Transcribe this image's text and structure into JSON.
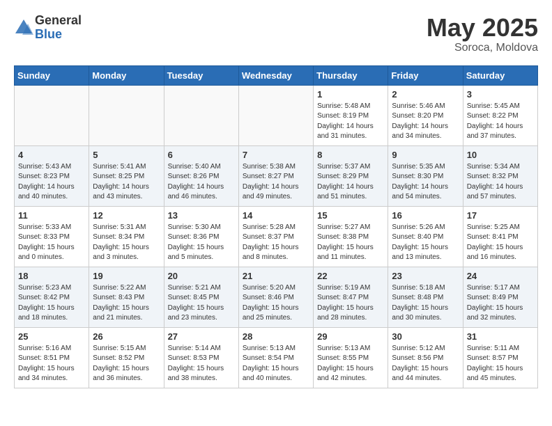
{
  "header": {
    "logo_general": "General",
    "logo_blue": "Blue",
    "month": "May 2025",
    "location": "Soroca, Moldova"
  },
  "days_of_week": [
    "Sunday",
    "Monday",
    "Tuesday",
    "Wednesday",
    "Thursday",
    "Friday",
    "Saturday"
  ],
  "weeks": [
    [
      {
        "day": "",
        "info": ""
      },
      {
        "day": "",
        "info": ""
      },
      {
        "day": "",
        "info": ""
      },
      {
        "day": "",
        "info": ""
      },
      {
        "day": "1",
        "info": "Sunrise: 5:48 AM\nSunset: 8:19 PM\nDaylight: 14 hours\nand 31 minutes."
      },
      {
        "day": "2",
        "info": "Sunrise: 5:46 AM\nSunset: 8:20 PM\nDaylight: 14 hours\nand 34 minutes."
      },
      {
        "day": "3",
        "info": "Sunrise: 5:45 AM\nSunset: 8:22 PM\nDaylight: 14 hours\nand 37 minutes."
      }
    ],
    [
      {
        "day": "4",
        "info": "Sunrise: 5:43 AM\nSunset: 8:23 PM\nDaylight: 14 hours\nand 40 minutes."
      },
      {
        "day": "5",
        "info": "Sunrise: 5:41 AM\nSunset: 8:25 PM\nDaylight: 14 hours\nand 43 minutes."
      },
      {
        "day": "6",
        "info": "Sunrise: 5:40 AM\nSunset: 8:26 PM\nDaylight: 14 hours\nand 46 minutes."
      },
      {
        "day": "7",
        "info": "Sunrise: 5:38 AM\nSunset: 8:27 PM\nDaylight: 14 hours\nand 49 minutes."
      },
      {
        "day": "8",
        "info": "Sunrise: 5:37 AM\nSunset: 8:29 PM\nDaylight: 14 hours\nand 51 minutes."
      },
      {
        "day": "9",
        "info": "Sunrise: 5:35 AM\nSunset: 8:30 PM\nDaylight: 14 hours\nand 54 minutes."
      },
      {
        "day": "10",
        "info": "Sunrise: 5:34 AM\nSunset: 8:32 PM\nDaylight: 14 hours\nand 57 minutes."
      }
    ],
    [
      {
        "day": "11",
        "info": "Sunrise: 5:33 AM\nSunset: 8:33 PM\nDaylight: 15 hours\nand 0 minutes."
      },
      {
        "day": "12",
        "info": "Sunrise: 5:31 AM\nSunset: 8:34 PM\nDaylight: 15 hours\nand 3 minutes."
      },
      {
        "day": "13",
        "info": "Sunrise: 5:30 AM\nSunset: 8:36 PM\nDaylight: 15 hours\nand 5 minutes."
      },
      {
        "day": "14",
        "info": "Sunrise: 5:28 AM\nSunset: 8:37 PM\nDaylight: 15 hours\nand 8 minutes."
      },
      {
        "day": "15",
        "info": "Sunrise: 5:27 AM\nSunset: 8:38 PM\nDaylight: 15 hours\nand 11 minutes."
      },
      {
        "day": "16",
        "info": "Sunrise: 5:26 AM\nSunset: 8:40 PM\nDaylight: 15 hours\nand 13 minutes."
      },
      {
        "day": "17",
        "info": "Sunrise: 5:25 AM\nSunset: 8:41 PM\nDaylight: 15 hours\nand 16 minutes."
      }
    ],
    [
      {
        "day": "18",
        "info": "Sunrise: 5:23 AM\nSunset: 8:42 PM\nDaylight: 15 hours\nand 18 minutes."
      },
      {
        "day": "19",
        "info": "Sunrise: 5:22 AM\nSunset: 8:43 PM\nDaylight: 15 hours\nand 21 minutes."
      },
      {
        "day": "20",
        "info": "Sunrise: 5:21 AM\nSunset: 8:45 PM\nDaylight: 15 hours\nand 23 minutes."
      },
      {
        "day": "21",
        "info": "Sunrise: 5:20 AM\nSunset: 8:46 PM\nDaylight: 15 hours\nand 25 minutes."
      },
      {
        "day": "22",
        "info": "Sunrise: 5:19 AM\nSunset: 8:47 PM\nDaylight: 15 hours\nand 28 minutes."
      },
      {
        "day": "23",
        "info": "Sunrise: 5:18 AM\nSunset: 8:48 PM\nDaylight: 15 hours\nand 30 minutes."
      },
      {
        "day": "24",
        "info": "Sunrise: 5:17 AM\nSunset: 8:49 PM\nDaylight: 15 hours\nand 32 minutes."
      }
    ],
    [
      {
        "day": "25",
        "info": "Sunrise: 5:16 AM\nSunset: 8:51 PM\nDaylight: 15 hours\nand 34 minutes."
      },
      {
        "day": "26",
        "info": "Sunrise: 5:15 AM\nSunset: 8:52 PM\nDaylight: 15 hours\nand 36 minutes."
      },
      {
        "day": "27",
        "info": "Sunrise: 5:14 AM\nSunset: 8:53 PM\nDaylight: 15 hours\nand 38 minutes."
      },
      {
        "day": "28",
        "info": "Sunrise: 5:13 AM\nSunset: 8:54 PM\nDaylight: 15 hours\nand 40 minutes."
      },
      {
        "day": "29",
        "info": "Sunrise: 5:13 AM\nSunset: 8:55 PM\nDaylight: 15 hours\nand 42 minutes."
      },
      {
        "day": "30",
        "info": "Sunrise: 5:12 AM\nSunset: 8:56 PM\nDaylight: 15 hours\nand 44 minutes."
      },
      {
        "day": "31",
        "info": "Sunrise: 5:11 AM\nSunset: 8:57 PM\nDaylight: 15 hours\nand 45 minutes."
      }
    ]
  ]
}
